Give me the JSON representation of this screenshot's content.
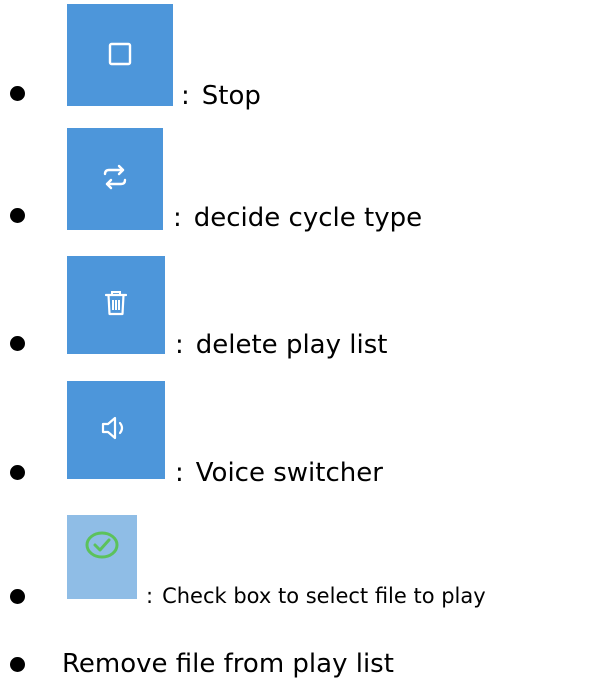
{
  "items": [
    {
      "icon": "stop-icon",
      "separator": ":",
      "label": "Stop"
    },
    {
      "icon": "repeat-icon",
      "separator": ":",
      "label": "decide cycle type"
    },
    {
      "icon": "trash-icon",
      "separator": ":",
      "label": "delete play list"
    },
    {
      "icon": "speaker-icon",
      "separator": ":",
      "label": "Voice switcher"
    },
    {
      "icon": "check-circle-icon",
      "separator": ":",
      "label": "Check box to select file to play"
    },
    {
      "label": "Remove file from play list"
    }
  ],
  "colors": {
    "tile_blue": "#4d96da",
    "tile_light_blue": "#8fbde6",
    "icon_white": "#ffffff",
    "check_green": "#5cc25c"
  }
}
